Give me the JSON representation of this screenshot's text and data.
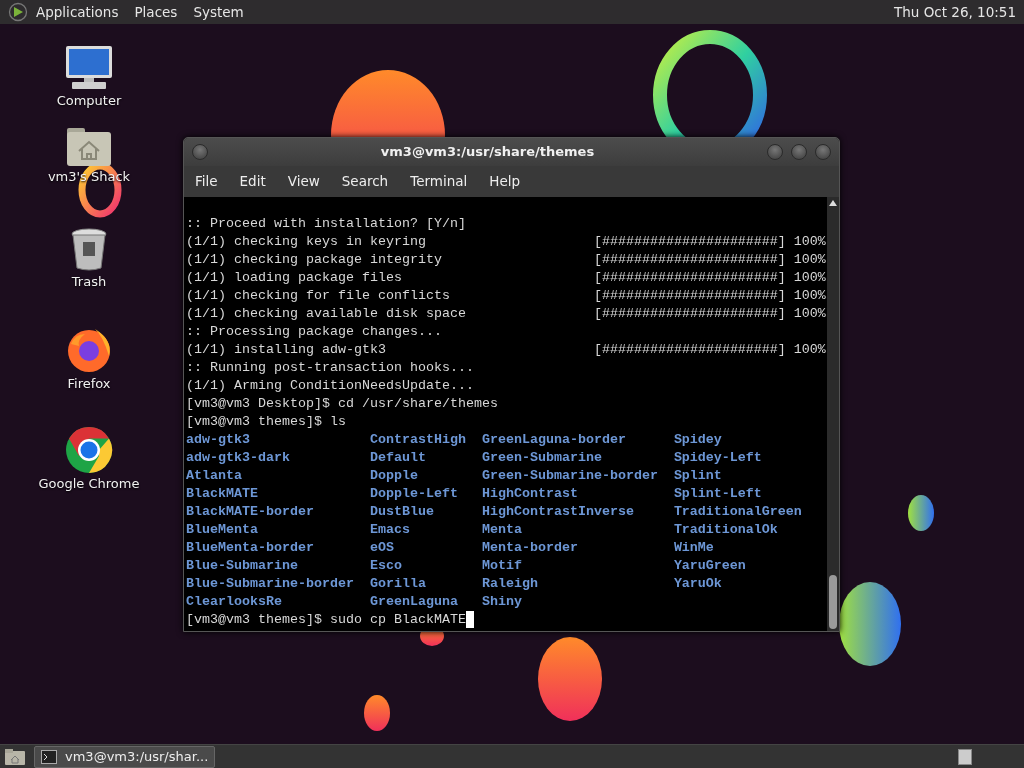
{
  "top_panel": {
    "menus": [
      "Applications",
      "Places",
      "System"
    ],
    "clock": "Thu Oct 26, 10:51"
  },
  "desktop_icons": [
    {
      "label": "Computer",
      "kind": "computer"
    },
    {
      "label": "vm3's Shack",
      "kind": "home"
    },
    {
      "label": "Trash",
      "kind": "trash"
    },
    {
      "label": "Firefox",
      "kind": "firefox"
    },
    {
      "label": "Google Chrome",
      "kind": "chrome"
    }
  ],
  "terminal": {
    "title": "vm3@vm3:/usr/share/themes",
    "menus": [
      "File",
      "Edit",
      "View",
      "Search",
      "Terminal",
      "Help"
    ],
    "lines": [
      {
        "text": ":: Proceed with installation? [Y/n]"
      },
      {
        "text": "(1/1) checking keys in keyring",
        "progress": "[######################] 100%"
      },
      {
        "text": "(1/1) checking package integrity",
        "progress": "[######################] 100%"
      },
      {
        "text": "(1/1) loading package files",
        "progress": "[######################] 100%"
      },
      {
        "text": "(1/1) checking for file conflicts",
        "progress": "[######################] 100%"
      },
      {
        "text": "(1/1) checking available disk space",
        "progress": "[######################] 100%"
      },
      {
        "text": ":: Processing package changes..."
      },
      {
        "text": "(1/1) installing adw-gtk3",
        "progress": "[######################] 100%"
      },
      {
        "text": ":: Running post-transaction hooks..."
      },
      {
        "text": "(1/1) Arming ConditionNeedsUpdate..."
      },
      {
        "text": "[vm3@vm3 Desktop]$ cd /usr/share/themes"
      },
      {
        "text": "[vm3@vm3 themes]$ ls"
      }
    ],
    "listing": [
      [
        "adw-gtk3",
        "ContrastHigh",
        "GreenLaguna-border",
        "Spidey"
      ],
      [
        "adw-gtk3-dark",
        "Default",
        "Green-Submarine",
        "Spidey-Left"
      ],
      [
        "Atlanta",
        "Dopple",
        "Green-Submarine-border",
        "Splint"
      ],
      [
        "BlackMATE",
        "Dopple-Left",
        "HighContrast",
        "Splint-Left"
      ],
      [
        "BlackMATE-border",
        "DustBlue",
        "HighContrastInverse",
        "TraditionalGreen"
      ],
      [
        "BlueMenta",
        "Emacs",
        "Menta",
        "TraditionalOk"
      ],
      [
        "BlueMenta-border",
        "eOS",
        "Menta-border",
        "WinMe"
      ],
      [
        "Blue-Submarine",
        "Esco",
        "Motif",
        "YaruGreen"
      ],
      [
        "Blue-Submarine-border",
        "Gorilla",
        "Raleigh",
        "YaruOk"
      ],
      [
        "ClearlooksRe",
        "GreenLaguna",
        "Shiny"
      ]
    ],
    "prompt": "[vm3@vm3 themes]$ sudo cp BlackMATE"
  },
  "taskbar": {
    "tasks": [
      "vm3@vm3:/usr/shar..."
    ]
  }
}
